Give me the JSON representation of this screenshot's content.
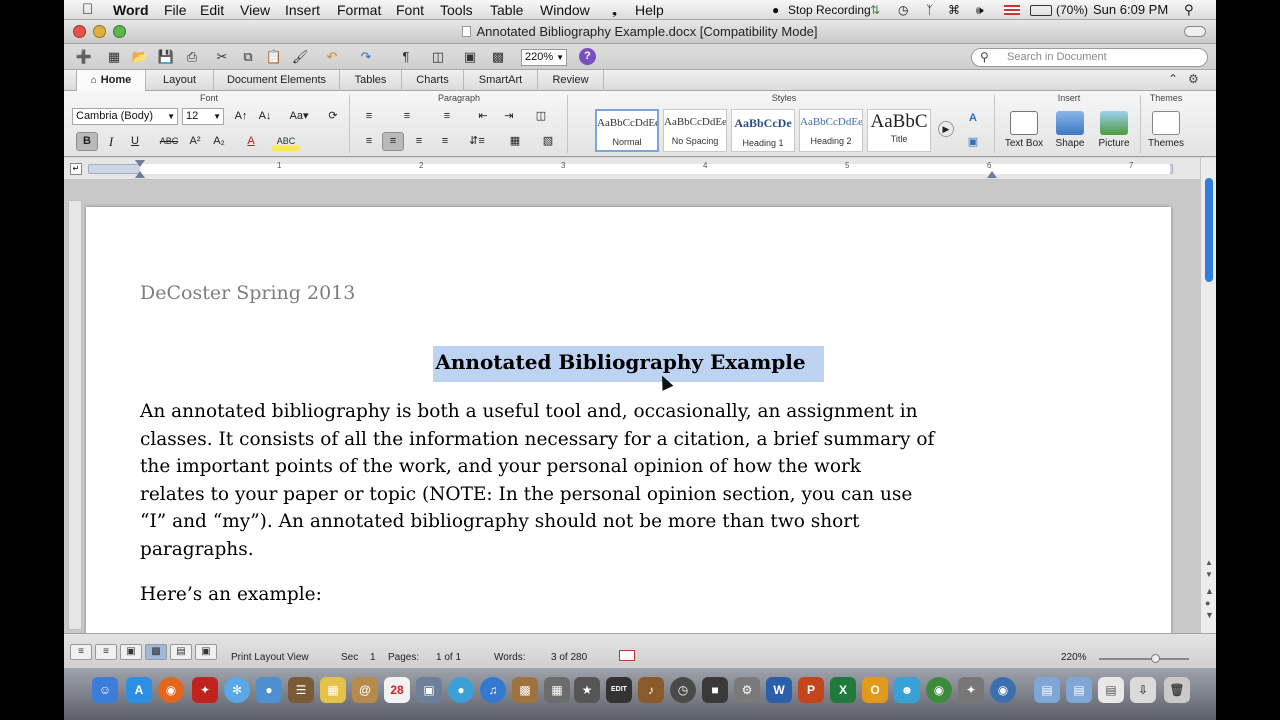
{
  "menubar": {
    "app_name": "Word",
    "items": [
      "File",
      "Edit",
      "View",
      "Insert",
      "Format",
      "Font",
      "Tools",
      "Table",
      "Window",
      "Help"
    ],
    "stop_recording": "Stop Recording",
    "battery": "(70%)",
    "clock": "Sun 6:09 PM"
  },
  "window": {
    "title": "Annotated Bibliography Example.docx [Compatibility Mode]"
  },
  "toolbar": {
    "zoom": "220%",
    "search_placeholder": "Search in Document"
  },
  "ribbon_tabs": [
    "Home",
    "Layout",
    "Document Elements",
    "Tables",
    "Charts",
    "SmartArt",
    "Review"
  ],
  "ribbon": {
    "groups": {
      "font": "Font",
      "paragraph": "Paragraph",
      "styles": "Styles",
      "insert": "Insert",
      "themes": "Themes"
    },
    "font_name": "Cambria (Body)",
    "font_size": "12",
    "styles": [
      {
        "preview": "AaBbCcDdEe",
        "name": "Normal"
      },
      {
        "preview": "AaBbCcDdEe",
        "name": "No Spacing"
      },
      {
        "preview": "AaBbCcDe",
        "name": "Heading 1"
      },
      {
        "preview": "AaBbCcDdEe",
        "name": "Heading 2"
      },
      {
        "preview": "AaBbC",
        "name": "Title"
      }
    ],
    "insert_items": [
      "Text Box",
      "Shape",
      "Picture"
    ],
    "themes_label": "Themes"
  },
  "ruler": {
    "numbers": [
      "1",
      "2",
      "3",
      "4",
      "5",
      "6",
      "7"
    ]
  },
  "document": {
    "header": "DeCoster Spring 2013",
    "title": "Annotated Bibliography Example",
    "lines": [
      "An annotated bibliography is both a useful tool and, occasionally, an assignment in",
      "classes. It consists of all the information necessary for a citation, a brief summary of",
      "the important points of the work, and your personal opinion of how the work",
      "relates to your paper or topic (NOTE: In the personal opinion section, you can use",
      "“I” and “my”). An annotated bibliography should not be more than two short",
      "paragraphs."
    ],
    "example_line": "Here’s an example:"
  },
  "status": {
    "view": "Print Layout View",
    "sec_label": "Sec",
    "sec_value": "1",
    "pages_label": "Pages:",
    "pages_value": "1 of 1",
    "words_label": "Words:",
    "words_value": "3 of 280",
    "zoom": "220%"
  },
  "colors": {
    "accent": "#2f7ee0",
    "selection": "#bdd3f2"
  }
}
